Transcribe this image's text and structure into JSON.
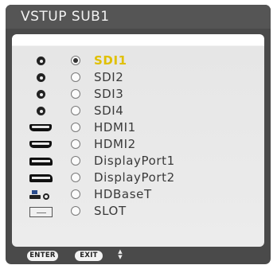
{
  "window": {
    "title": "VSTUP SUB1"
  },
  "inputs": [
    {
      "label": "SDI1",
      "icon": "sdi-connector-icon",
      "selected": true
    },
    {
      "label": "SDI2",
      "icon": "sdi-connector-icon",
      "selected": false
    },
    {
      "label": "SDI3",
      "icon": "sdi-connector-icon",
      "selected": false
    },
    {
      "label": "SDI4",
      "icon": "sdi-connector-icon",
      "selected": false
    },
    {
      "label": "HDMI1",
      "icon": "hdmi-port-icon",
      "selected": false
    },
    {
      "label": "HDMI2",
      "icon": "hdmi-port-icon",
      "selected": false
    },
    {
      "label": "DisplayPort1",
      "icon": "displayport-port-icon",
      "selected": false
    },
    {
      "label": "DisplayPort2",
      "icon": "displayport-port-icon",
      "selected": false
    },
    {
      "label": "HDBaseT",
      "icon": "hdbaset-icon",
      "selected": false
    },
    {
      "label": "SLOT",
      "icon": "slot-icon",
      "selected": false
    }
  ],
  "footer": {
    "enter_label": "ENTER",
    "exit_label": "EXIT",
    "navigate_icon": "up-down-arrows-icon"
  },
  "colors": {
    "selected_text": "#e0c000",
    "window_bg": "#4a4a4a",
    "panel_bg": "#ececec"
  }
}
